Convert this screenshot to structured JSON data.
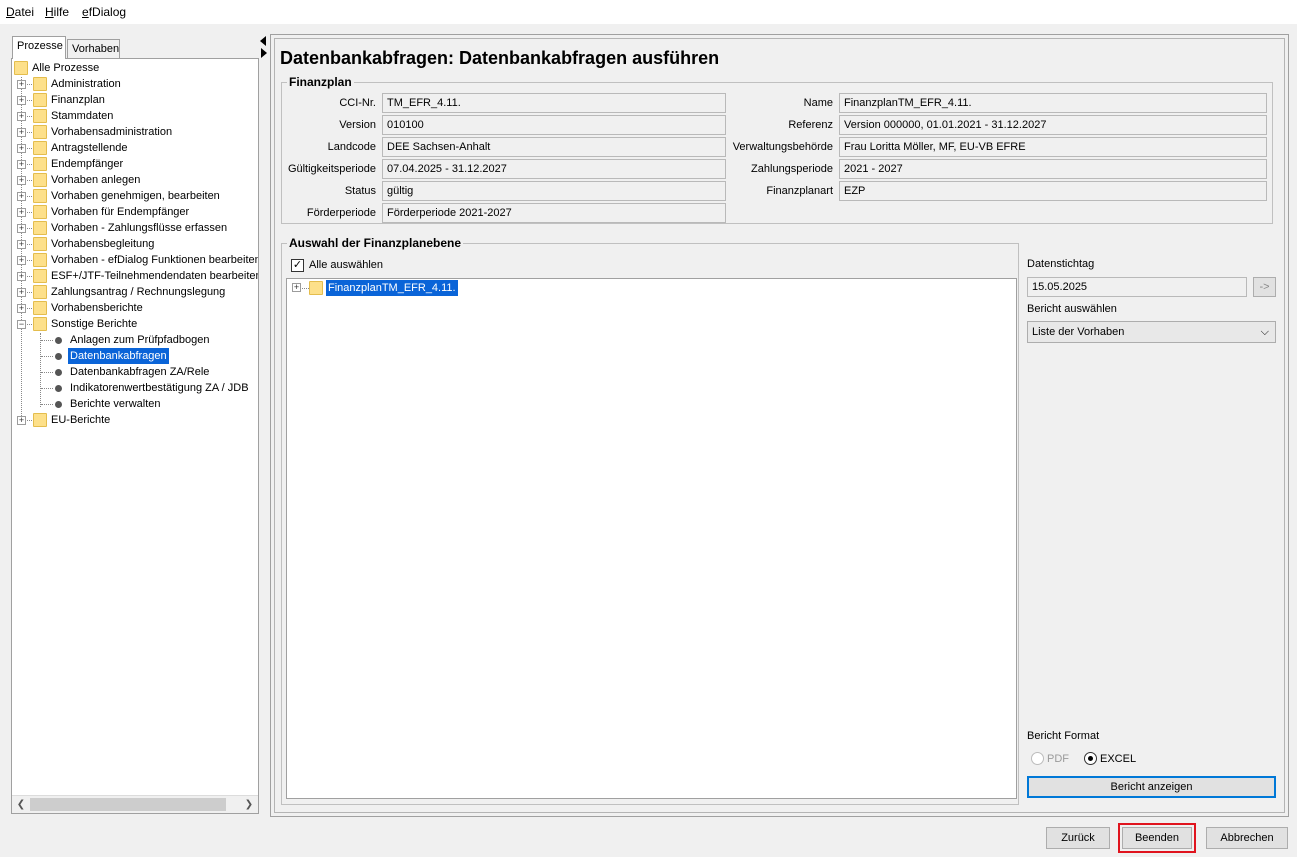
{
  "menu": [
    "Datei",
    "Hilfe",
    "efDialog"
  ],
  "left_tabs": [
    "Prozesse",
    "Vorhaben"
  ],
  "tree": {
    "root": "Alle Prozesse",
    "items": [
      "Administration",
      "Finanzplan",
      "Stammdaten",
      "Vorhabensadministration",
      "Antragstellende",
      "Endempfänger",
      "Vorhaben anlegen",
      "Vorhaben genehmigen, bearbeiten",
      "Vorhaben für Endempfänger",
      "Vorhaben - Zahlungsflüsse erfassen",
      "Vorhabensbegleitung",
      "Vorhaben - efDialog Funktionen bearbeiten",
      "ESF+/JTF-Teilnehmendendaten bearbeiten",
      "Zahlungsantrag / Rechnungslegung",
      "Vorhabensberichte",
      "Sonstige Berichte"
    ],
    "children": [
      "Anlagen zum Prüfpfadbogen",
      "Datenbankabfragen",
      "Datenbankabfragen ZA/Rele",
      "Indikatorenwertbestätigung ZA / JDB",
      "Berichte verwalten"
    ],
    "last": "EU-Berichte"
  },
  "page_title": "Datenbankabfragen: Datenbankabfragen ausführen",
  "finanzplan": {
    "legend": "Finanzplan",
    "left": [
      {
        "label": "CCI-Nr.",
        "value": "TM_EFR_4.11."
      },
      {
        "label": "Version",
        "value": "010100"
      },
      {
        "label": "Landcode",
        "value": "DEE Sachsen-Anhalt"
      },
      {
        "label": "Gültigkeitsperiode",
        "value": "07.04.2025 - 31.12.2027"
      },
      {
        "label": "Status",
        "value": "gültig"
      },
      {
        "label": "Förderperiode",
        "value": "Förderperiode 2021-2027"
      }
    ],
    "right": [
      {
        "label": "Name",
        "value": "FinanzplanTM_EFR_4.11."
      },
      {
        "label": "Referenz",
        "value": "Version 000000,  01.01.2021 - 31.12.2027"
      },
      {
        "label": "Verwaltungsbehörde",
        "value": "Frau Loritta Möller,  MF, EU-VB EFRE"
      },
      {
        "label": "Zahlungsperiode",
        "value": "2021 - 2027"
      },
      {
        "label": "Finanzplanart",
        "value": "EZP"
      }
    ]
  },
  "auswahl": {
    "legend": "Auswahl der Finanzplanebene",
    "select_all": "Alle auswählen",
    "tree_item": "FinanzplanTM_EFR_4.11."
  },
  "side": {
    "datenstichtag_label": "Datenstichtag",
    "datenstichtag_value": "15.05.2025",
    "go_label": "->",
    "bericht_label": "Bericht auswählen",
    "bericht_value": "Liste der Vorhaben",
    "format_label": "Bericht Format",
    "pdf": "PDF",
    "excel": "EXCEL",
    "show_button": "Bericht anzeigen"
  },
  "footer": {
    "back": "Zurück",
    "finish": "Beenden",
    "cancel": "Abbrechen"
  },
  "colors": {
    "selection": "#0a64d8",
    "highlight": "#e0141e",
    "folder": "#fde08a"
  }
}
